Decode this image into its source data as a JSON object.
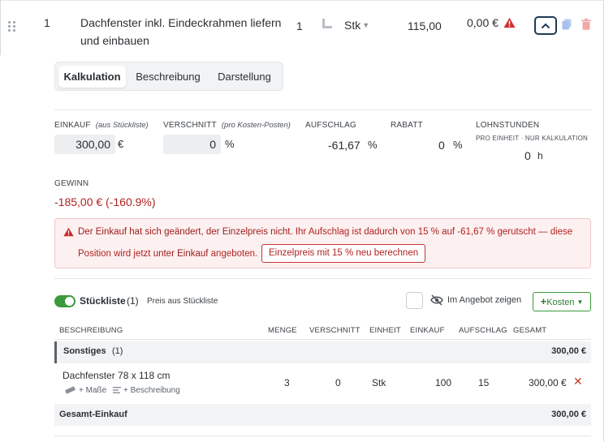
{
  "position": {
    "number": "1",
    "description": "Dachfenster inkl. Eindeckrahmen liefern und einbauen",
    "quantity": "1",
    "unit": "Stk",
    "unit_price": "115,00",
    "total": "0,00 €"
  },
  "tabs": [
    {
      "label": "Kalkulation",
      "active": true
    },
    {
      "label": "Beschreibung",
      "active": false
    },
    {
      "label": "Darstellung",
      "active": false
    }
  ],
  "calc": {
    "einkauf_label": "EINKAUF",
    "einkauf_hint": "(aus Stückliste)",
    "einkauf_value": "300,00",
    "einkauf_unit": "€",
    "verschnitt_label": "VERSCHNITT",
    "verschnitt_hint": "(pro Kosten-Posten)",
    "verschnitt_value": "0",
    "verschnitt_unit": "%",
    "aufschlag_label": "AUFSCHLAG",
    "aufschlag_value": "-61,67",
    "aufschlag_unit": "%",
    "rabatt_label": "RABATT",
    "rabatt_value": "0",
    "rabatt_unit": "%",
    "lohn_label": "LOHNSTUNDEN",
    "lohn_hint": "PRO EINHEIT · NUR KALKULATION",
    "lohn_value": "0",
    "lohn_unit": "h"
  },
  "gewinn": {
    "label": "GEWINN",
    "value": "-185,00 € (-160.9%)"
  },
  "alert": {
    "strong": "Der Einkauf hat sich geändert, der Einzelpreis nicht.",
    "text1": " Ihr Aufschlag ist dadurch von 15 % auf -61,67 % gerutscht — diese",
    "text2a": "Position wird jetzt ",
    "text2b": "unter Einkauf",
    "text2c": " angeboten.",
    "button": "Einzelpreis mit 15 % neu berechnen"
  },
  "stueckliste": {
    "label": "Stückliste",
    "count": "(1)",
    "note": "Preis aus Stückliste",
    "show_label": "Im Angebot zeigen",
    "kosten_button": "Kosten",
    "headers": {
      "beschreibung": "BESCHREIBUNG",
      "menge": "MENGE",
      "verschnitt": "VERSCHNITT",
      "einheit": "EINHEIT",
      "einkauf": "EINKAUF",
      "aufschlag": "AUFSCHLAG",
      "gesamt": "GESAMT"
    },
    "group": {
      "name": "Sonstiges",
      "count": "(1)",
      "total": "300,00 €"
    },
    "item": {
      "name": "Dachfenster 78 x 118 cm",
      "menge": "3",
      "verschnitt": "0",
      "einheit": "Stk",
      "einkauf": "100",
      "aufschlag": "15",
      "gesamt": "300,00 €",
      "masse_link": "+ Maße",
      "beschreibung_link": "+ Beschreibung"
    },
    "sum": {
      "label": "Gesamt-Einkauf",
      "total": "300,00 €"
    }
  },
  "colors": {
    "accent_green": "#3c9a3c",
    "danger_red": "#b22222",
    "navy": "#203a55"
  }
}
